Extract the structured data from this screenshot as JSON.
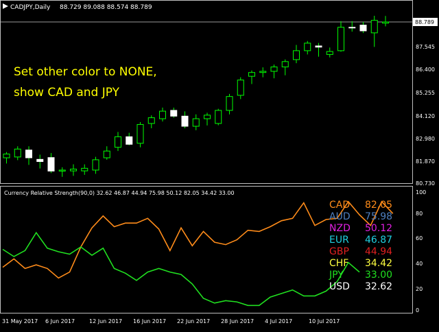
{
  "main_chart": {
    "header": {
      "symbol_timeframe": "CADJPY,Daily",
      "ohlc": "88.729 89.088 88.574 88.789"
    },
    "annotation_lines": [
      "Set other color to NONE,",
      "show CAD and JPY"
    ],
    "annotation_color": "#FFFF00",
    "current_price_label": "88.789",
    "price_axis_labels": [
      "87.545",
      "86.400",
      "85.255",
      "84.120",
      "82.980",
      "81.870",
      "80.730"
    ]
  },
  "indicator": {
    "header": "Currency Relative Strength(90,0) 32.62 46.87 44.94 75.98 50.12 82.05 34.42 33.00",
    "axis_labels": [
      "100",
      "80",
      "60",
      "40",
      "20",
      "0"
    ],
    "legend": [
      {
        "currency": "CAD",
        "value": "82.05",
        "color": "#FF8C1A"
      },
      {
        "currency": "AUD",
        "value": "75.98",
        "color": "#4F7FBF"
      },
      {
        "currency": "NZD",
        "value": "50.12",
        "color": "#E020E0"
      },
      {
        "currency": "EUR",
        "value": "46.87",
        "color": "#20D0E0"
      },
      {
        "currency": "GBP",
        "value": "44.94",
        "color": "#E02020"
      },
      {
        "currency": "CHF",
        "value": "34.42",
        "color": "#FFFF40"
      },
      {
        "currency": "JPY",
        "value": "33.00",
        "color": "#20E020"
      },
      {
        "currency": "USD",
        "value": "32.62",
        "color": "#FFFFFF"
      }
    ]
  },
  "time_axis_labels": [
    "31 May 2017",
    "6 Jun 2017",
    "12 Jun 2017",
    "16 Jun 2017",
    "22 Jun 2017",
    "28 Jun 2017",
    "4 Jul 2017",
    "10 Jul 2017"
  ],
  "chart_data": [
    {
      "type": "candlestick",
      "title": "CADJPY,Daily",
      "ylim": [
        80.73,
        89.1
      ],
      "candles": [
        {
          "o": 81.94,
          "h": 82.23,
          "l": 81.65,
          "c": 82.13
        },
        {
          "o": 81.98,
          "h": 82.52,
          "l": 81.82,
          "c": 82.38
        },
        {
          "o": 82.33,
          "h": 82.52,
          "l": 81.58,
          "c": 81.94
        },
        {
          "o": 81.86,
          "h": 82.1,
          "l": 81.4,
          "c": 81.75
        },
        {
          "o": 81.95,
          "h": 82.18,
          "l": 81.17,
          "c": 81.27
        },
        {
          "o": 81.27,
          "h": 81.46,
          "l": 80.98,
          "c": 81.32
        },
        {
          "o": 81.28,
          "h": 81.61,
          "l": 81.03,
          "c": 81.37
        },
        {
          "o": 81.28,
          "h": 81.61,
          "l": 81.08,
          "c": 81.41
        },
        {
          "o": 81.32,
          "h": 81.99,
          "l": 81.13,
          "c": 81.84
        },
        {
          "o": 81.94,
          "h": 82.52,
          "l": 81.84,
          "c": 82.28
        },
        {
          "o": 82.47,
          "h": 83.24,
          "l": 82.28,
          "c": 83.0
        },
        {
          "o": 83.0,
          "h": 83.2,
          "l": 82.57,
          "c": 82.62
        },
        {
          "o": 82.67,
          "h": 83.74,
          "l": 82.47,
          "c": 83.62
        },
        {
          "o": 83.67,
          "h": 84.08,
          "l": 83.43,
          "c": 83.96
        },
        {
          "o": 83.91,
          "h": 84.47,
          "l": 83.77,
          "c": 84.29
        },
        {
          "o": 84.33,
          "h": 84.47,
          "l": 83.96,
          "c": 84.04
        },
        {
          "o": 84.04,
          "h": 84.28,
          "l": 83.43,
          "c": 83.53
        },
        {
          "o": 83.53,
          "h": 84.13,
          "l": 83.33,
          "c": 83.91
        },
        {
          "o": 83.91,
          "h": 84.21,
          "l": 83.57,
          "c": 84.09
        },
        {
          "o": 83.67,
          "h": 84.41,
          "l": 83.58,
          "c": 84.33
        },
        {
          "o": 84.33,
          "h": 85.16,
          "l": 84.13,
          "c": 85.03
        },
        {
          "o": 85.09,
          "h": 86.0,
          "l": 84.9,
          "c": 85.86
        },
        {
          "o": 86.05,
          "h": 86.34,
          "l": 85.66,
          "c": 86.24
        },
        {
          "o": 86.24,
          "h": 86.5,
          "l": 86.0,
          "c": 86.3
        },
        {
          "o": 86.3,
          "h": 86.64,
          "l": 85.95,
          "c": 86.52
        },
        {
          "o": 86.52,
          "h": 86.9,
          "l": 86.1,
          "c": 86.79
        },
        {
          "o": 86.89,
          "h": 87.63,
          "l": 86.71,
          "c": 87.34
        },
        {
          "o": 87.34,
          "h": 87.83,
          "l": 87.15,
          "c": 87.72
        },
        {
          "o": 87.58,
          "h": 87.73,
          "l": 87.04,
          "c": 87.52
        },
        {
          "o": 87.15,
          "h": 87.5,
          "l": 87.0,
          "c": 87.3
        },
        {
          "o": 87.34,
          "h": 88.83,
          "l": 87.29,
          "c": 88.52
        },
        {
          "o": 88.52,
          "h": 88.83,
          "l": 88.3,
          "c": 88.5
        },
        {
          "o": 88.63,
          "h": 88.79,
          "l": 88.23,
          "c": 88.34
        },
        {
          "o": 88.24,
          "h": 89.1,
          "l": 87.53,
          "c": 88.87
        },
        {
          "o": 88.73,
          "h": 89.09,
          "l": 88.57,
          "c": 88.79
        }
      ]
    },
    {
      "type": "line",
      "title": "Currency Relative Strength(90,0)",
      "ylim": [
        0,
        100
      ],
      "series": [
        {
          "name": "CAD",
          "color": "#FF8C1A",
          "values": [
            37,
            44,
            36,
            39,
            36,
            28,
            33,
            54,
            70,
            80,
            71,
            74,
            74,
            78,
            69,
            51,
            70,
            55,
            67,
            58,
            56,
            60,
            68,
            67,
            71,
            76,
            78,
            91,
            72,
            77,
            78,
            92,
            81,
            72,
            92,
            82
          ]
        },
        {
          "name": "JPY",
          "color": "#20E020",
          "values": [
            52,
            46,
            51,
            66,
            53,
            50,
            48,
            54,
            47,
            53,
            36,
            32,
            26,
            33,
            36,
            33,
            31,
            23,
            11,
            7,
            9,
            8,
            5,
            5,
            12,
            15,
            18,
            13,
            13,
            17,
            25,
            41,
            33
          ]
        }
      ]
    }
  ]
}
